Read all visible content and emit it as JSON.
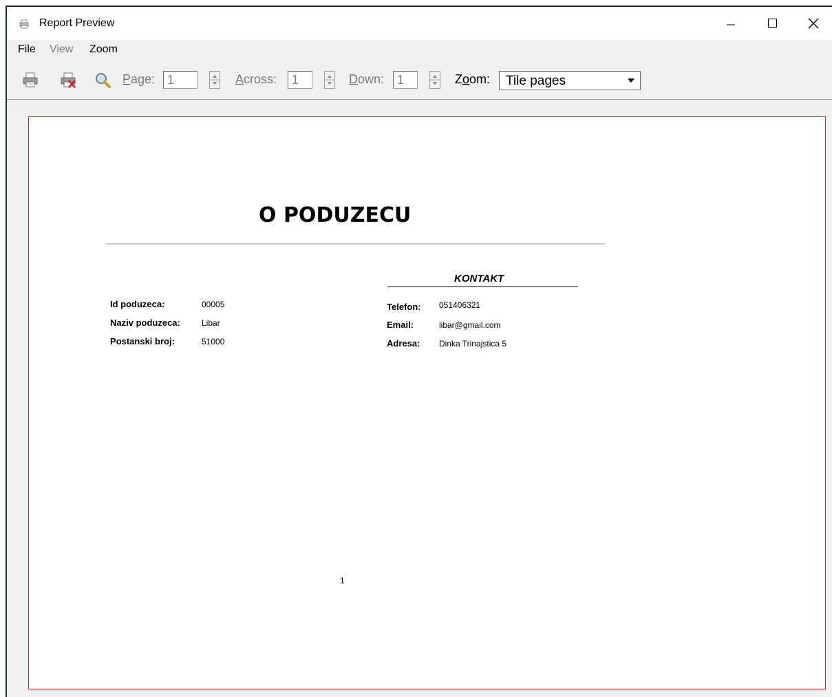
{
  "window": {
    "title": "Report Preview"
  },
  "menu": {
    "file": "File",
    "view": "View",
    "zoom": "Zoom"
  },
  "toolbar": {
    "page_label_u": "P",
    "page_label_rest": "age:",
    "page_value": "1",
    "across_label_u": "A",
    "across_label_rest": "cross:",
    "across_value": "1",
    "down_label_u": "D",
    "down_label_rest": "own:",
    "down_value": "1",
    "zoom_label_pre": "Z",
    "zoom_label_u": "o",
    "zoom_label_rest": "om:",
    "zoom_value": "Tile pages"
  },
  "report": {
    "title": "O PODUZECU",
    "kontakt_heading": "KONTAKT",
    "id_label": "Id poduzeca:",
    "id_value": "00005",
    "naziv_label": "Naziv poduzeca:",
    "naziv_value": "Libar",
    "post_label": "Postanski broj:",
    "post_value": "51000",
    "telefon_label": "Telefon:",
    "telefon_value": "051406321",
    "email_label": "Email:",
    "email_value": "libar@gmail.com",
    "adresa_label": "Adresa:",
    "adresa_value": "Dinka Trinajstica 5",
    "page_number": "1"
  },
  "colors": {
    "page_border": "#e0201c",
    "window_border": "#1c2a3d"
  }
}
